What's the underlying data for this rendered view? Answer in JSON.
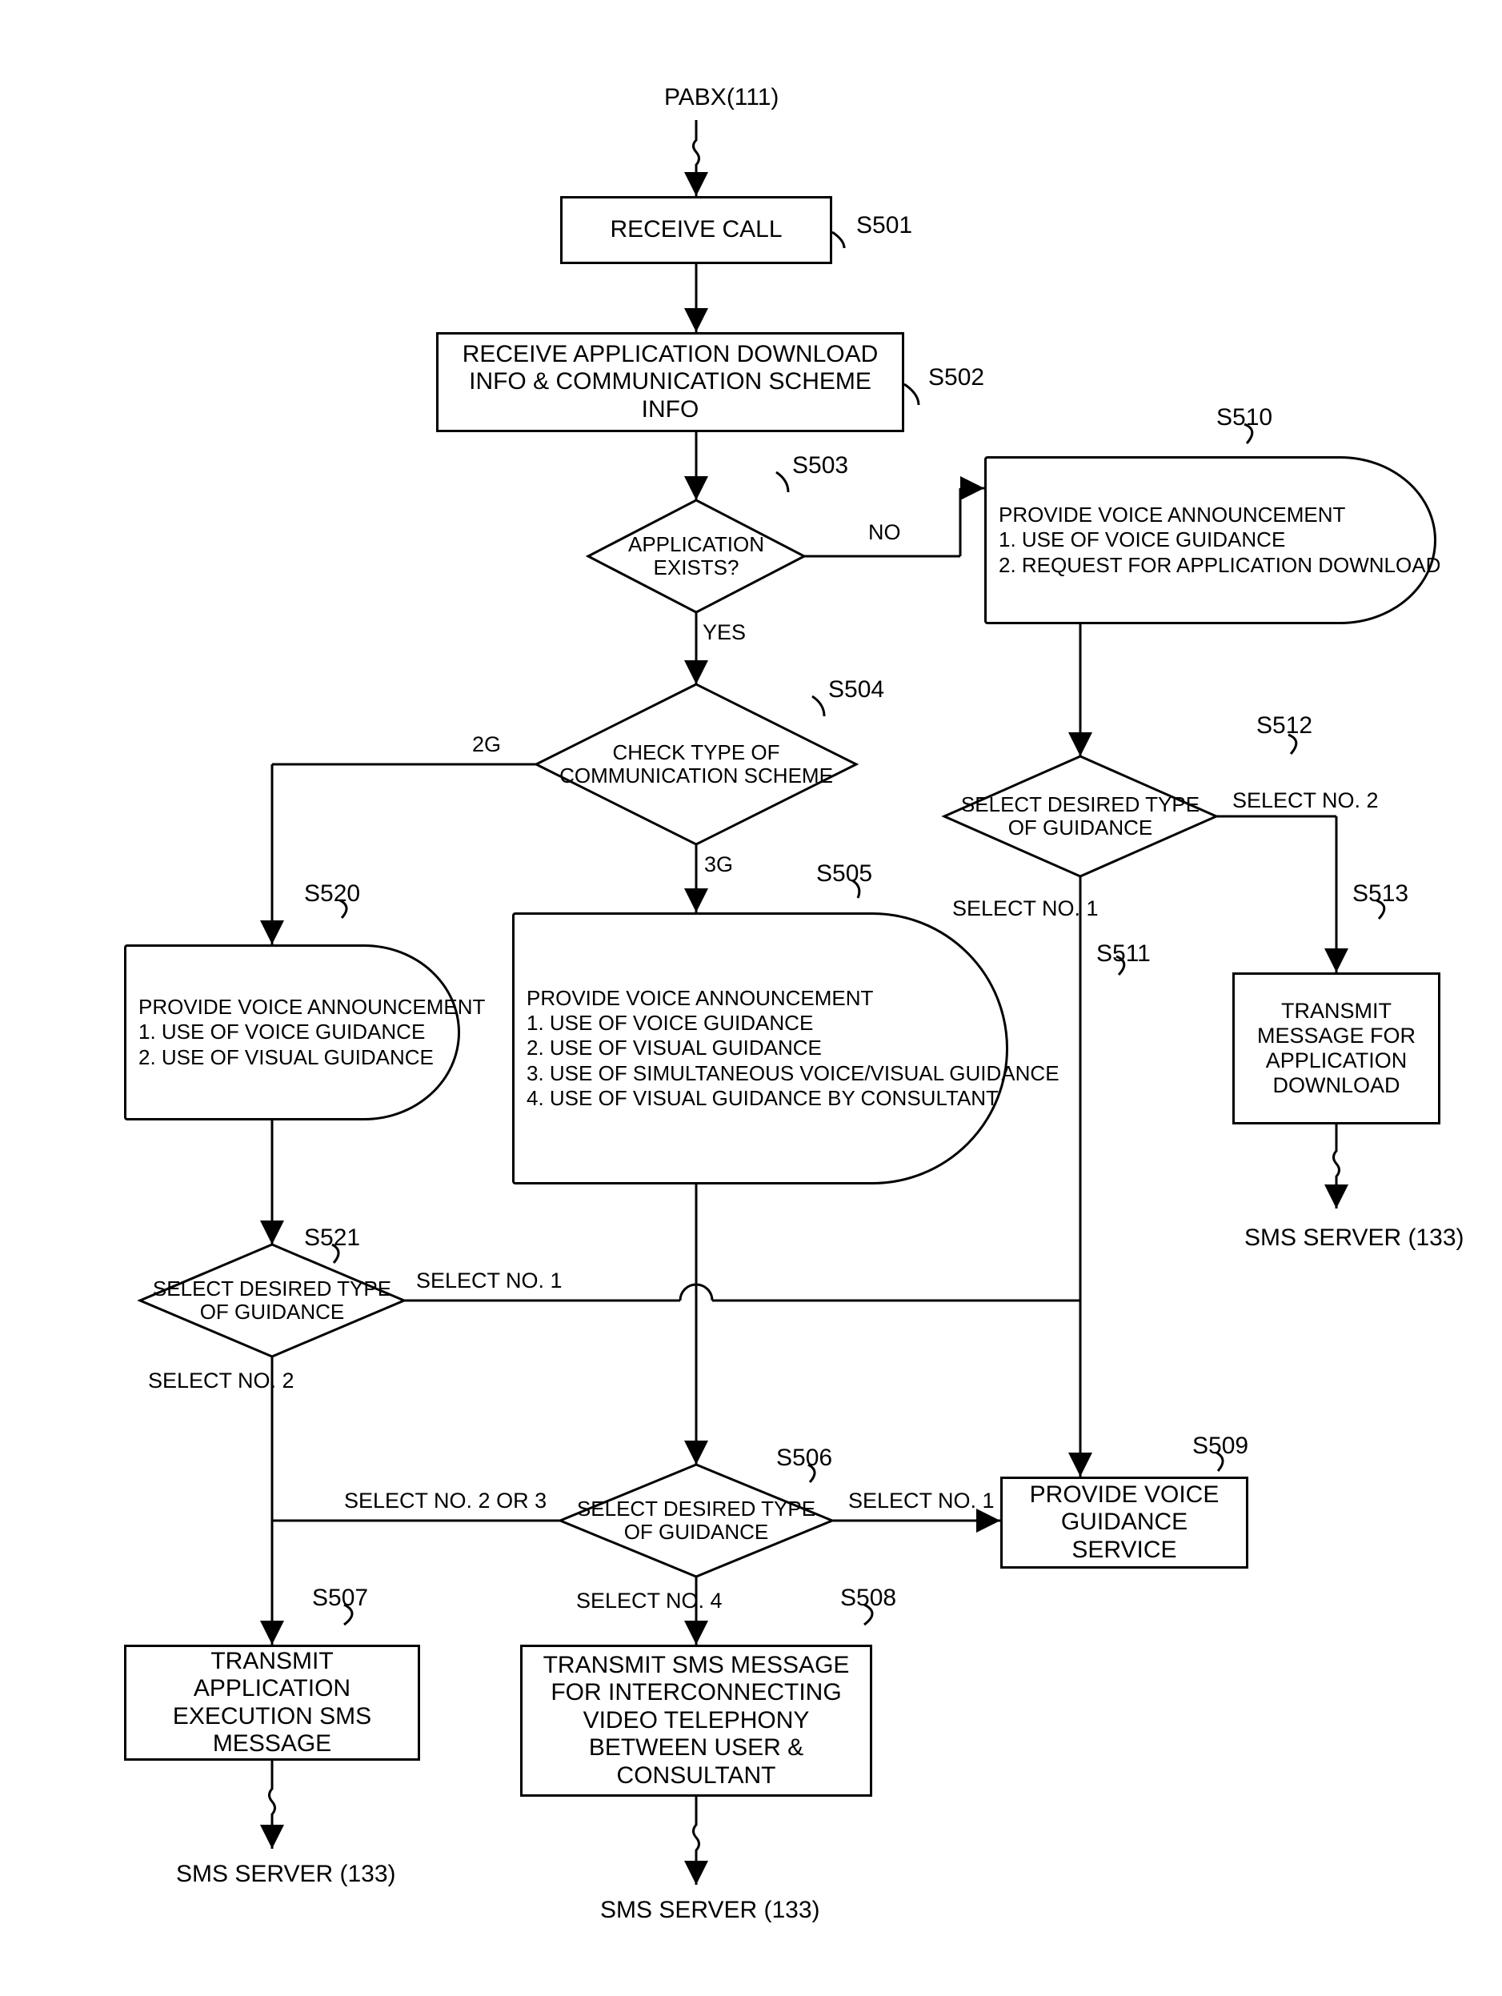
{
  "header": {
    "pabx": "PABX(111)"
  },
  "steps": {
    "s501": {
      "id": "S501",
      "text": "RECEIVE CALL"
    },
    "s502": {
      "id": "S502",
      "text": "RECEIVE APPLICATION DOWNLOAD INFO & COMMUNICATION SCHEME INFO"
    },
    "s503": {
      "id": "S503",
      "text": "APPLICATION EXISTS?",
      "yes": "YES",
      "no": "NO"
    },
    "s504": {
      "id": "S504",
      "text": "CHECK TYPE OF COMMUNICATION SCHEME",
      "b2g": "2G",
      "b3g": "3G"
    },
    "s505": {
      "id": "S505",
      "l0": "PROVIDE VOICE ANNOUNCEMENT",
      "l1": "1. USE OF VOICE GUIDANCE",
      "l2": "2. USE OF VISUAL GUIDANCE",
      "l3": "3. USE OF SIMULTANEOUS VOICE/VISUAL GUIDANCE",
      "l4": "4. USE OF VISUAL GUIDANCE BY CONSULTANT"
    },
    "s506": {
      "id": "S506",
      "text": "SELECT DESIRED TYPE OF GUIDANCE",
      "sel1": "SELECT NO. 1",
      "sel23": "SELECT NO. 2 OR 3",
      "sel4": "SELECT NO. 4"
    },
    "s507": {
      "id": "S507",
      "text": "TRANSMIT APPLICATION EXECUTION SMS MESSAGE",
      "dest": "SMS SERVER (133)"
    },
    "s508": {
      "id": "S508",
      "text": "TRANSMIT SMS MESSAGE FOR INTERCONNECTING VIDEO TELEPHONY BETWEEN USER & CONSULTANT",
      "dest": "SMS SERVER (133)"
    },
    "s509": {
      "id": "S509",
      "text": "PROVIDE VOICE GUIDANCE SERVICE"
    },
    "s510": {
      "id": "S510",
      "l0": "PROVIDE VOICE ANNOUNCEMENT",
      "l1": "1. USE OF VOICE GUIDANCE",
      "l2": "2. REQUEST FOR APPLICATION DOWNLOAD"
    },
    "s511": {
      "id": "S511"
    },
    "s512": {
      "id": "S512",
      "text": "SELECT DESIRED TYPE OF GUIDANCE",
      "sel1": "SELECT NO. 1",
      "sel2": "SELECT NO. 2"
    },
    "s513": {
      "id": "S513",
      "text": "TRANSMIT MESSAGE FOR APPLICATION DOWNLOAD",
      "dest": "SMS SERVER (133)"
    },
    "s520": {
      "id": "S520",
      "l0": "PROVIDE VOICE ANNOUNCEMENT",
      "l1": "1. USE OF VOICE GUIDANCE",
      "l2": "2. USE OF VISUAL GUIDANCE"
    },
    "s521": {
      "id": "S521",
      "text": "SELECT DESIRED TYPE OF GUIDANCE",
      "sel1": "SELECT NO. 1",
      "sel2": "SELECT NO. 2"
    }
  }
}
